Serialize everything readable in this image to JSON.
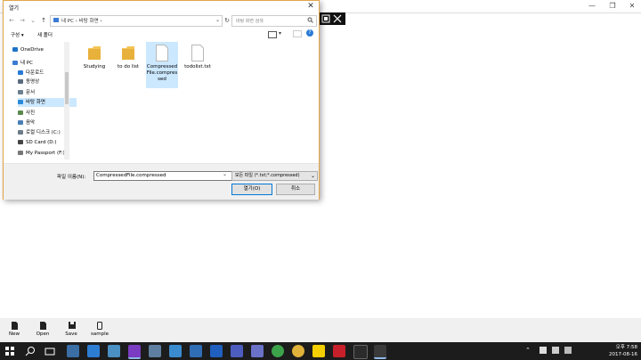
{
  "dialog": {
    "title": "열기",
    "close_glyph": "✕",
    "address": {
      "path_parts": [
        "내 PC",
        "›",
        "바탕 화면",
        "›"
      ]
    },
    "search_placeholder": "바탕 화면 검색",
    "commands": {
      "organize": "구성 ▾",
      "new_folder": "새 폴더"
    },
    "nav_items": [
      {
        "label": "OneDrive",
        "color": "#1e73c8"
      },
      {
        "label": "내 PC",
        "color": "#3b7bd4"
      },
      {
        "label": "다운로드",
        "color": "#2a7ad6"
      },
      {
        "label": "동영상",
        "color": "#5a6b7c"
      },
      {
        "label": "문서",
        "color": "#6b7f8f"
      },
      {
        "label": "바탕 화면",
        "color": "#2a8ad8"
      },
      {
        "label": "사진",
        "color": "#5a8a4e"
      },
      {
        "label": "음악",
        "color": "#4a7fb5"
      },
      {
        "label": "로컬 디스크 (C:)",
        "color": "#6d7b87"
      },
      {
        "label": "SD Card (D:)",
        "color": "#444444"
      },
      {
        "label": "My Passport (F:)",
        "color": "#777777"
      }
    ],
    "files": [
      {
        "name": "Studying",
        "kind": "folder"
      },
      {
        "name": "to do list",
        "kind": "folder"
      },
      {
        "name": "CompressedFile.compressed",
        "kind": "file",
        "selected": true
      },
      {
        "name": "todolist.txt",
        "kind": "file"
      }
    ],
    "filename_label": "파일 이름(N):",
    "filename_value": "CompressedFile.compressed",
    "filter_value": "모든 파일 (*.txt;*.compressed)",
    "open_label": "열기(O)",
    "cancel_label": "취소"
  },
  "bottom_bar": [
    {
      "label": "New"
    },
    {
      "label": "Open"
    },
    {
      "label": "Save"
    },
    {
      "label": "sample"
    }
  ],
  "tray": {
    "time": "오후 7:58",
    "date": "2017-08-16"
  },
  "colors": {
    "accent": "#0078d7",
    "folder": "#f3c556",
    "selection": "#cce8ff",
    "taskbar": "#1c1c1c"
  }
}
